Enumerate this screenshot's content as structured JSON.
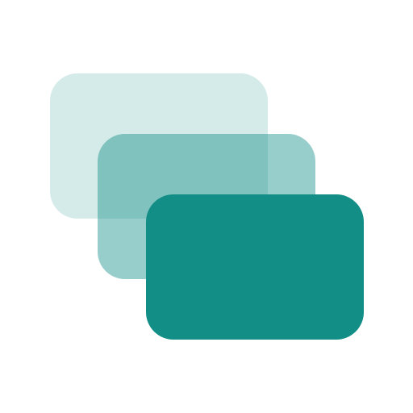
{
  "icon": {
    "name": "stacked-cards-icon",
    "background_color": "#ffffff",
    "card_color": "#128e87"
  }
}
